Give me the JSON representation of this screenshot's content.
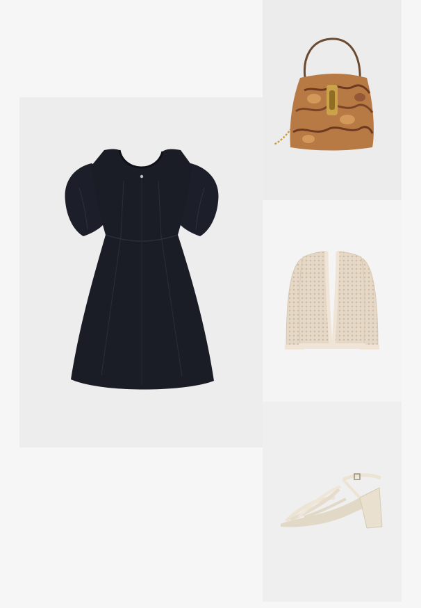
{
  "outfit": {
    "items": [
      {
        "id": "dress",
        "icon": "black-puff-sleeve-dress-image",
        "color": "#1a1d26"
      },
      {
        "id": "bag",
        "icon": "snakeskin-shoulder-bag-image",
        "color": "#b77a45"
      },
      {
        "id": "cardigan",
        "icon": "crochet-cardigan-image",
        "color": "#e6d8c6"
      },
      {
        "id": "sandals",
        "icon": "strappy-block-heel-sandal-image",
        "color": "#e9e0cf"
      }
    ]
  },
  "colors": {
    "page_background": "#f6f6f6",
    "tile_background": "#ececec"
  }
}
